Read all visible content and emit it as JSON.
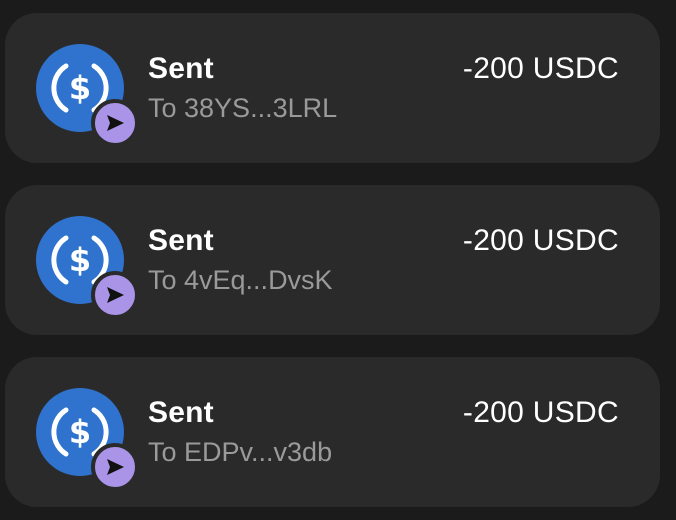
{
  "colors": {
    "background": "#1b1b1b",
    "card": "#2a2a2a",
    "usdc_blue": "#2f73cf",
    "sent_badge": "#a994e8",
    "subtitle_gray": "#9a9a9a"
  },
  "transactions": [
    {
      "title": "Sent",
      "subtitle": "To 38YS...3LRL",
      "amount": "-200 USDC",
      "token_icon": "usdc-icon",
      "badge_icon": "send-arrow-icon"
    },
    {
      "title": "Sent",
      "subtitle": "To 4vEq...DvsK",
      "amount": "-200 USDC",
      "token_icon": "usdc-icon",
      "badge_icon": "send-arrow-icon"
    },
    {
      "title": "Sent",
      "subtitle": "To EDPv...v3db",
      "amount": "-200 USDC",
      "token_icon": "usdc-icon",
      "badge_icon": "send-arrow-icon"
    }
  ]
}
